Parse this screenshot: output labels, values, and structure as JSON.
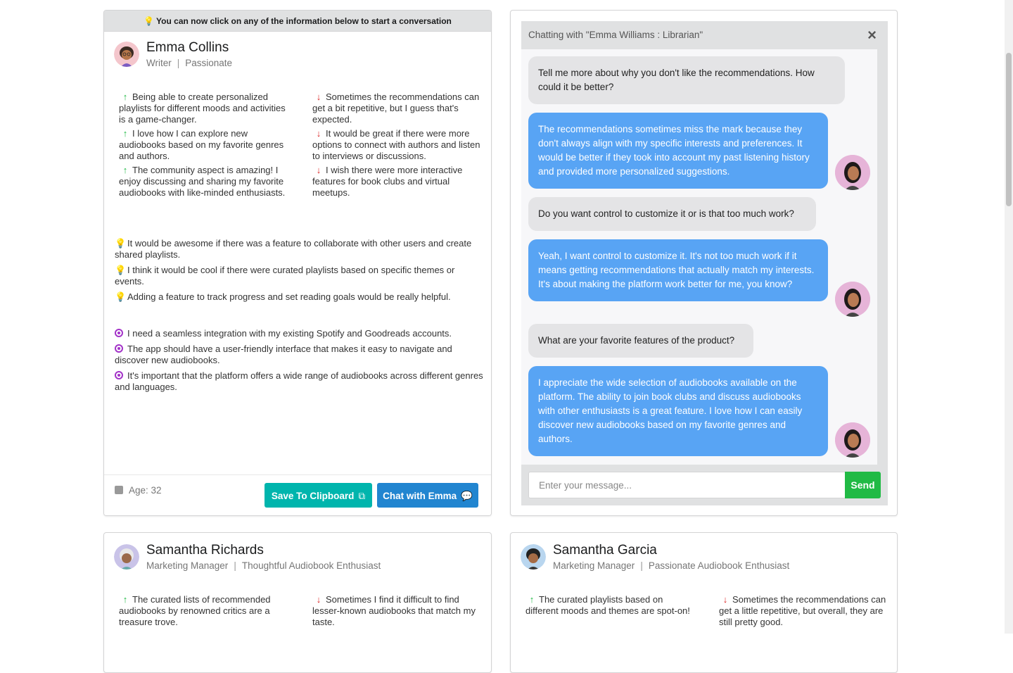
{
  "banner": {
    "text": "You can now click on any of the information below to start a conversation"
  },
  "persona1": {
    "name": "Emma Collins",
    "role": "Writer",
    "trait": "Passionate",
    "likes": [
      "Being able to create personalized playlists for different moods and activities is a game-changer.",
      "I love how I can explore new audiobooks based on my favorite genres and authors.",
      "The community aspect is amazing! I enjoy discussing and sharing my favorite audiobooks with like-minded enthusiasts."
    ],
    "dislikes": [
      "Sometimes the recommendations can get a bit repetitive, but I guess that's expected.",
      "It would be great if there were more options to connect with authors and listen to interviews or discussions.",
      "I wish there were more interactive features for book clubs and virtual meetups."
    ],
    "ideas": [
      "It would be awesome if there was a feature to collaborate with other users and create shared playlists.",
      "I think it would be cool if there were curated playlists based on specific themes or events.",
      "Adding a feature to track progress and set reading goals would be really helpful."
    ],
    "goals": [
      "I need a seamless integration with my existing Spotify and Goodreads accounts.",
      "The app should have a user-friendly interface that makes it easy to navigate and discover new audiobooks.",
      "It's important that the platform offers a wide range of audiobooks across different genres and languages."
    ],
    "age_label": "Age: 32",
    "save_label": "Save To Clipboard",
    "chat_label": "Chat with Emma"
  },
  "chat": {
    "title": "Chatting with \"Emma Williams : Librarian\"",
    "close_icon": "×",
    "messages": [
      {
        "from": "interviewer",
        "text": "Tell me more about why you don't like the recommendations. How could it be better?"
      },
      {
        "from": "persona",
        "text": "The recommendations sometimes miss the mark because they don't always align with my specific interests and preferences. It would be better if they took into account my past listening history and provided more personalized suggestions."
      },
      {
        "from": "interviewer",
        "text": "Do you want control to customize it or is that too much work?"
      },
      {
        "from": "persona",
        "text": "Yeah, I want control to customize it. It's not too much work if it means getting recommendations that actually match my interests. It's about making the platform work better for me, you know?"
      },
      {
        "from": "interviewer",
        "text": "What are your favorite features of the product?"
      },
      {
        "from": "persona",
        "text": "I appreciate the wide selection of audiobooks available on the platform. The ability to join book clubs and discuss audiobooks with other enthusiasts is a great feature. I love how I can easily discover new audiobooks based on my favorite genres and authors."
      }
    ],
    "input_placeholder": "Enter your message...",
    "send_label": "Send"
  },
  "persona2": {
    "name": "Samantha Richards",
    "role": "Marketing Manager",
    "trait": "Thoughtful Audiobook Enthusiast",
    "likes": [
      "The curated lists of recommended audiobooks by renowned critics are a treasure trove."
    ],
    "dislikes": [
      "Sometimes I find it difficult to find lesser-known audiobooks that match my taste."
    ]
  },
  "persona3": {
    "name": "Samantha Garcia",
    "role": "Marketing Manager",
    "trait": "Passionate Audiobook Enthusiast",
    "likes": [
      "The curated playlists based on different moods and themes are spot-on!"
    ],
    "dislikes": [
      "Sometimes the recommendations can get a little repetitive, but overall, they are still pretty good."
    ]
  },
  "colors": {
    "teal": "#00b5ad",
    "blue": "#2185d0",
    "green": "#21ba45",
    "red": "#db2828",
    "bubble_persona": "#58a4f4",
    "bubble_interviewer": "#e4e4e6"
  }
}
